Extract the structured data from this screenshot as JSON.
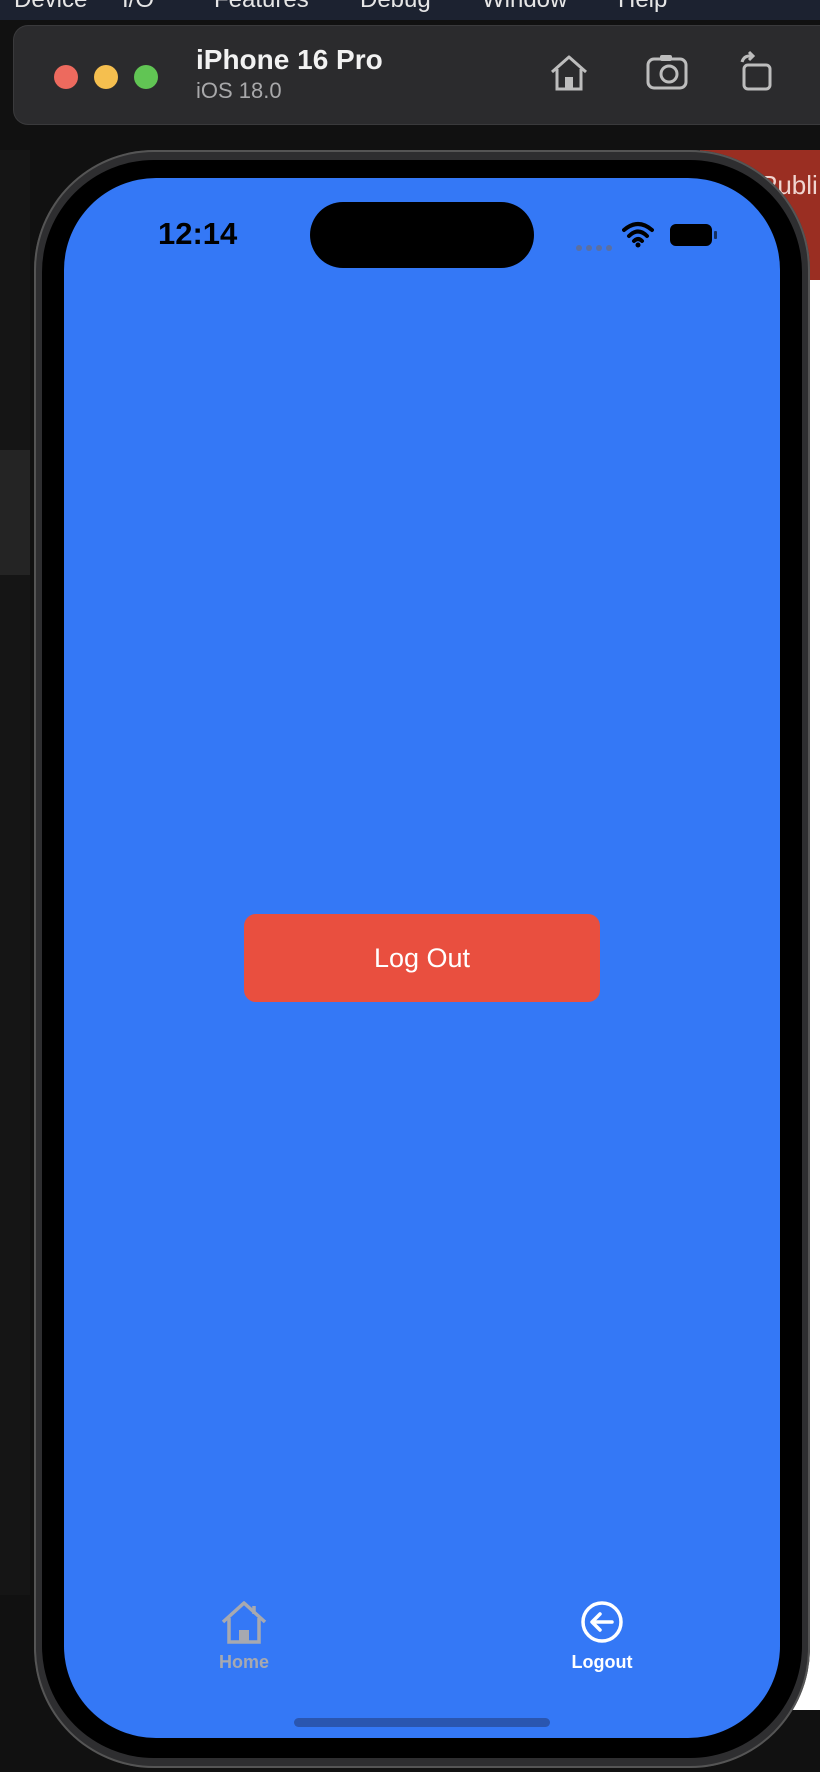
{
  "menubar": {
    "items": [
      "Device",
      "I/O",
      "Features",
      "Debug",
      "Window",
      "Help"
    ]
  },
  "toolbar": {
    "device_name": "iPhone 16 Pro",
    "os_version": "iOS 18.0",
    "icons": [
      "home-icon",
      "screenshot-icon",
      "rotate-icon"
    ]
  },
  "status_bar": {
    "time": "12:14"
  },
  "main": {
    "logout_button_label": "Log Out"
  },
  "tab_bar": {
    "tabs": [
      {
        "label": "Home",
        "icon": "home-icon",
        "active": false
      },
      {
        "label": "Logout",
        "icon": "logout-icon",
        "active": true
      }
    ]
  },
  "background_app": {
    "visible_text": "Publi"
  },
  "colors": {
    "screen_background": "#3478f6",
    "logout_button": "#e94f3f",
    "tab_inactive": "#a7a9b0",
    "tab_active": "#ffffff"
  }
}
